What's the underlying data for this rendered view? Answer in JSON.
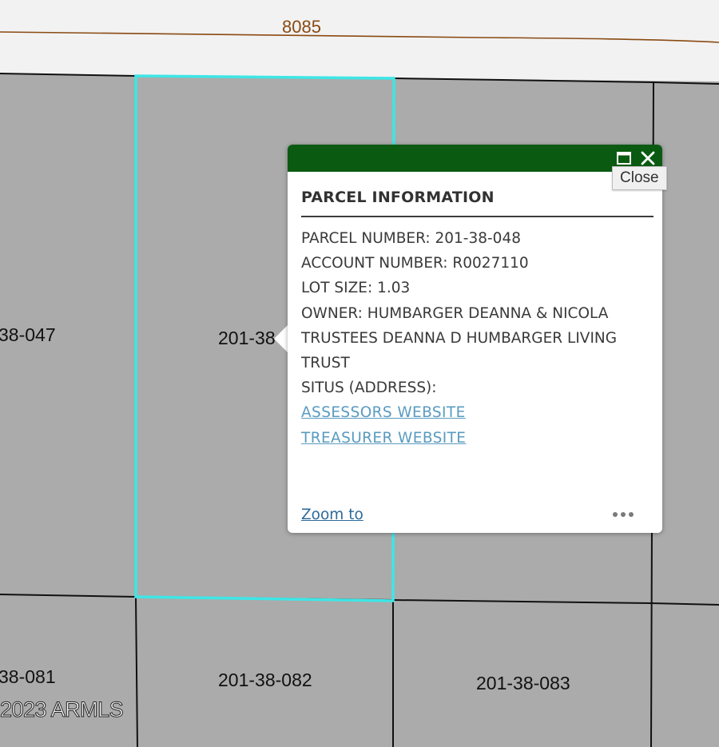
{
  "map": {
    "road_label": "8085",
    "parcel_labels": {
      "left_top": "38-047",
      "center_top": "201-38",
      "left_bottom": "38-081",
      "center_bottom": "201-38-082",
      "right_bottom": "201-38-083"
    },
    "copyright": "2023 ARMLS",
    "colors": {
      "parcel_fill": "#ababab",
      "road_fill": "#f2f2f2",
      "selected_outline": "#3ee6e6",
      "road_line": "#8a4a12"
    }
  },
  "popup": {
    "header_color": "#0b5a12",
    "maximize_icon": "maximize-icon",
    "close_icon": "close-icon",
    "close_tooltip": "Close",
    "title": "PARCEL INFORMATION",
    "lines": [
      "PARCEL NUMBER: 201-38-048",
      "ACCOUNT NUMBER: R0027110",
      "LOT SIZE: 1.03",
      "OWNER: HUMBARGER DEANNA & NICOLA",
      "TRUSTEES DEANNA D HUMBARGER LIVING",
      "TRUST",
      "SITUS (ADDRESS):"
    ],
    "links": {
      "assessors": "ASSESSORS WEBSITE",
      "treasurer": "TREASURER WEBSITE"
    },
    "zoom_to": "Zoom to",
    "more_icon": "more-options-icon"
  }
}
